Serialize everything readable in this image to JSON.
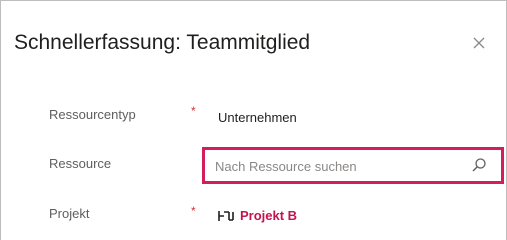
{
  "dialog": {
    "title": "Schnellerfassung: Teammitglied",
    "close_icon": "close-icon"
  },
  "fields": {
    "resource_type": {
      "label": "Ressourcentyp",
      "required_marker": "*",
      "value": "Unternehmen"
    },
    "resource": {
      "label": "Ressource",
      "placeholder": "Nach Ressource suchen",
      "value": "",
      "search_icon": "search-icon"
    },
    "project": {
      "label": "Projekt",
      "required_marker": "*",
      "value": "Projekt B",
      "icon": "project-entity-icon"
    }
  },
  "colors": {
    "highlight_border": "#d31d5c",
    "link": "#c4134f",
    "required": "#d13438"
  }
}
